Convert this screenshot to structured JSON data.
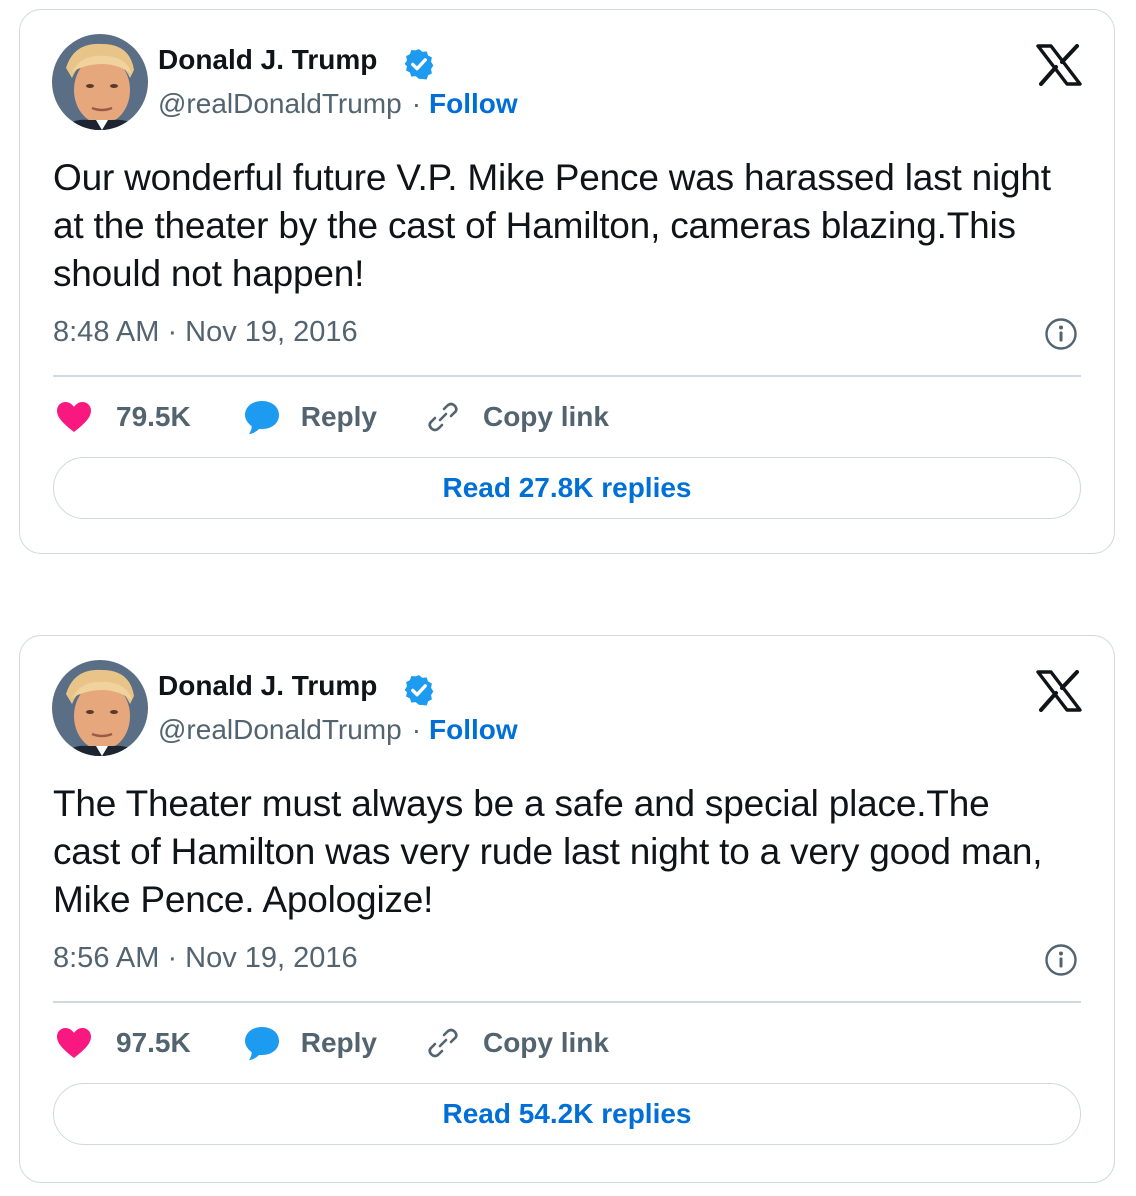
{
  "colors": {
    "like": "#f91880",
    "reply": "#1d9bf0",
    "link": "#006fd6",
    "secondary_text": "#536471",
    "border": "#cfd9de"
  },
  "tweets": [
    {
      "author": {
        "name": "Donald J. Trump",
        "handle": "@realDonaldTrump",
        "separator": "·",
        "follow_label": "Follow"
      },
      "text": "Our wonderful future V.P. Mike Pence was harassed last night at the theater by the cast of Hamilton, cameras blazing.This should not happen!",
      "timestamp": "8:48 AM · Nov 19, 2016",
      "likes": "79.5K",
      "reply_label": "Reply",
      "copy_label": "Copy link",
      "read_replies_label": "Read 27.8K replies"
    },
    {
      "author": {
        "name": "Donald J. Trump",
        "handle": "@realDonaldTrump",
        "separator": "·",
        "follow_label": "Follow"
      },
      "text": "The Theater must always be a safe and special place.The cast of Hamilton was very rude last night to a very good man, Mike Pence. Apologize!",
      "timestamp": "8:56 AM · Nov 19, 2016",
      "likes": "97.5K",
      "reply_label": "Reply",
      "copy_label": "Copy link",
      "read_replies_label": "Read 54.2K replies"
    }
  ],
  "icons": {
    "logo": "x-logo-icon",
    "verified": "verified-badge-icon",
    "info": "info-icon",
    "like": "heart-icon",
    "reply": "speech-bubble-icon",
    "copy": "link-icon"
  }
}
